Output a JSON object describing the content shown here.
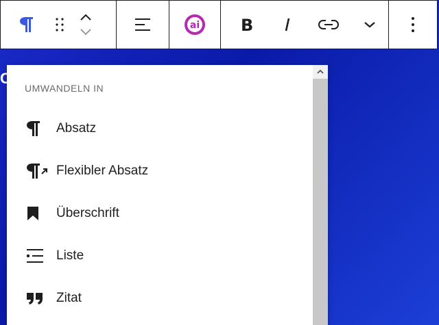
{
  "toolbar": {
    "icons": {
      "paragraph": "paragraph-icon",
      "drag": "drag-handle-icon",
      "move_up": "chevron-up-icon",
      "move_down": "chevron-down-icon",
      "align": "align-left-icon",
      "ai": "ai-assistant-icon",
      "bold": "bold-icon",
      "italic": "italic-icon",
      "link": "link-icon",
      "more_rich_text": "chevron-down-icon",
      "options": "more-vertical-icon"
    },
    "accent_color": "#3858e9",
    "ai_color": "#b42ab0"
  },
  "background": {
    "edge_text": "C",
    "gradient_colors": [
      "#1b2bc9",
      "#0a1aa8",
      "#1c3fd6"
    ]
  },
  "transform_menu": {
    "section_label": "UMWANDELN IN",
    "items": [
      {
        "label": "Absatz",
        "icon": "paragraph-icon"
      },
      {
        "label": "Flexibler Absatz",
        "icon": "paragraph-arrow-icon"
      },
      {
        "label": "Überschrift",
        "icon": "bookmark-icon"
      },
      {
        "label": "Liste",
        "icon": "list-icon"
      },
      {
        "label": "Zitat",
        "icon": "quote-icon"
      }
    ]
  }
}
